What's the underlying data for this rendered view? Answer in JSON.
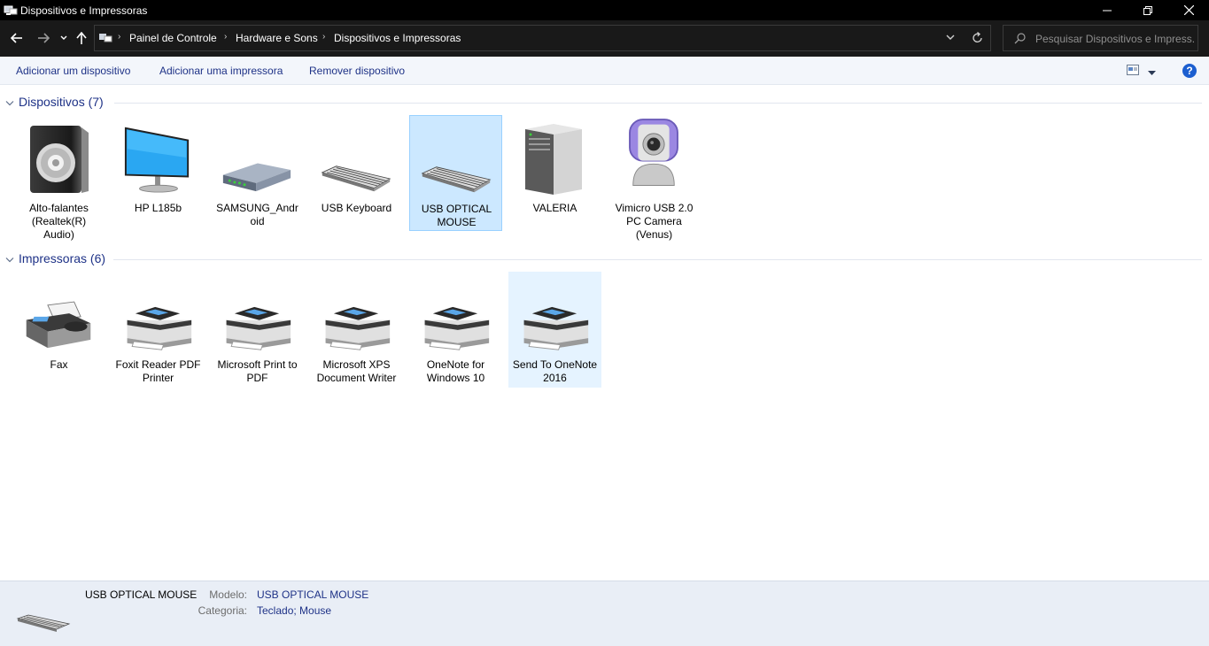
{
  "window": {
    "title": "Dispositivos e Impressoras"
  },
  "address": {
    "breadcrumbs": [
      "Painel de Controle",
      "Hardware e Sons",
      "Dispositivos e Impressoras"
    ],
    "search_placeholder": "Pesquisar Dispositivos e Impress..."
  },
  "commands": {
    "add_device": "Adicionar um dispositivo",
    "add_printer": "Adicionar uma impressora",
    "remove_device": "Remover dispositivo",
    "help": "?"
  },
  "groups": {
    "devices": {
      "title": "Dispositivos (7)",
      "items": [
        {
          "label": "Alto-falantes (Realtek(R) Audio)",
          "icon": "speaker-icon"
        },
        {
          "label": "HP L185b",
          "icon": "monitor-icon"
        },
        {
          "label": "SAMSUNG_Android",
          "icon": "router-icon"
        },
        {
          "label": "USB Keyboard",
          "icon": "keyboard-icon"
        },
        {
          "label": "USB OPTICAL MOUSE",
          "icon": "keyboard-icon"
        },
        {
          "label": "VALERIA",
          "icon": "computer-tower-icon"
        },
        {
          "label": "Vimicro USB 2.0 PC Camera (Venus)",
          "icon": "webcam-icon"
        }
      ]
    },
    "printers": {
      "title": "Impressoras (6)",
      "items": [
        {
          "label": "Fax",
          "icon": "fax-icon"
        },
        {
          "label": "Foxit Reader PDF Printer",
          "icon": "printer-icon"
        },
        {
          "label": "Microsoft Print to PDF",
          "icon": "printer-icon"
        },
        {
          "label": "Microsoft XPS Document Writer",
          "icon": "printer-icon"
        },
        {
          "label": "OneNote for Windows 10",
          "icon": "printer-icon"
        },
        {
          "label": "Send To OneNote 2016",
          "icon": "printer-icon"
        }
      ]
    }
  },
  "details": {
    "name": "USB OPTICAL MOUSE",
    "model_key": "Modelo:",
    "model_value": "USB OPTICAL MOUSE",
    "category_key": "Categoria:",
    "category_value": "Teclado; Mouse"
  },
  "colors": {
    "titlebar": "#000000",
    "addressbar": "#191919",
    "link_blue": "#1e3287",
    "selection": "#cce8ff",
    "hover": "#e5f3ff"
  }
}
